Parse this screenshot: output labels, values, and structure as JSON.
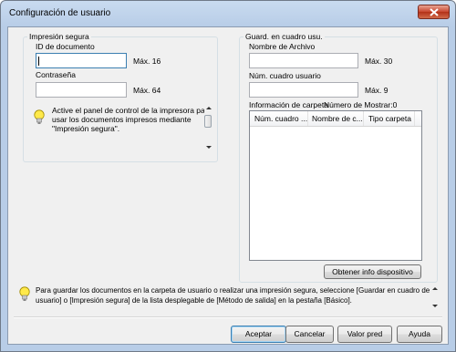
{
  "window": {
    "title": "Configuración de usuario"
  },
  "secure_print": {
    "group_title": "Impresión segura",
    "doc_id_label": "ID de documento",
    "doc_id_value": "",
    "doc_id_max": "Máx. 16",
    "password_label": "Contraseña",
    "password_value": "",
    "password_max": "Máx. 64",
    "hint_line1": "Active el panel de control de la impresora para",
    "hint_line2": "usar los documentos impresos mediante",
    "hint_line3": "\"Impresión segura\"."
  },
  "user_box": {
    "group_title": "Guard. en cuadro usu.",
    "filename_label": "Nombre de Archivo",
    "filename_value": "",
    "filename_max": "Máx. 30",
    "box_number_label": "Núm. cuadro usuario",
    "box_number_value": "",
    "box_number_max": "Máx. 9",
    "folder_info_label": "Información de carpeta",
    "show_number_label": "Número de Mostrar:0",
    "columns": [
      "Núm. cuadro ...",
      "Nombre de c...",
      "Tipo carpeta"
    ],
    "get_device_info_button": "Obtener info dispositivo"
  },
  "bottom_hint": {
    "line1": "Para guardar los documentos en la carpeta de usuario o realizar una impresión segura, seleccione [Guardar en cuadro de",
    "line2": "usuario] o [Impresión segura] de la lista desplegable de [Método de salida] en la pestaña [Básico]."
  },
  "buttons": {
    "accept": "Aceptar",
    "cancel": "Cancelar",
    "default_value": "Valor pred",
    "help": "Ayuda"
  },
  "icons": {
    "close": "close-icon",
    "hint": "lightbulb-icon"
  }
}
